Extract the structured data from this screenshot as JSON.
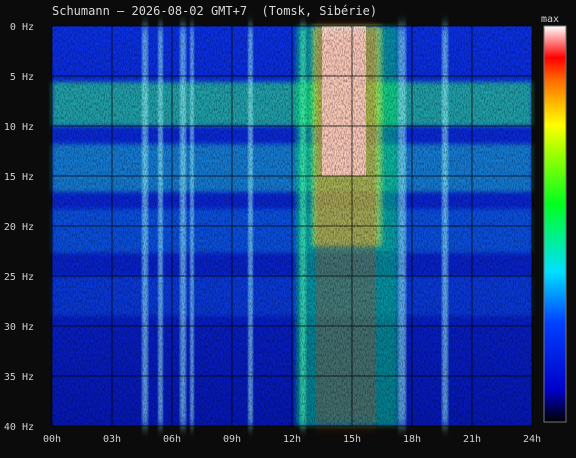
{
  "chart_data": {
    "type": "heatmap",
    "title": "Schumann – 2026-08-02 GMT+7  (Tomsk, Sibérie)",
    "x_ticks": [
      "00h",
      "03h",
      "06h",
      "09h",
      "12h",
      "15h",
      "18h",
      "21h",
      "24h"
    ],
    "y_ticks": [
      "0 Hz",
      "5 Hz",
      "10 Hz",
      "15 Hz",
      "20 Hz",
      "25 Hz",
      "30 Hz",
      "35 Hz",
      "40 Hz"
    ],
    "x_range_hours": [
      0,
      24
    ],
    "y_range_hz": [
      0,
      40
    ],
    "grid": true,
    "colorbar": {
      "label": "max",
      "position": "right",
      "colors": [
        "#000000",
        "#0000ff",
        "#00ffff",
        "#00ff00",
        "#ffff00",
        "#ff0000",
        "#ffffff"
      ]
    },
    "resonance_bands_hz": [
      7.8,
      14.2,
      20.5,
      27
    ],
    "high_activity_hours": [
      13,
      16.5
    ]
  }
}
